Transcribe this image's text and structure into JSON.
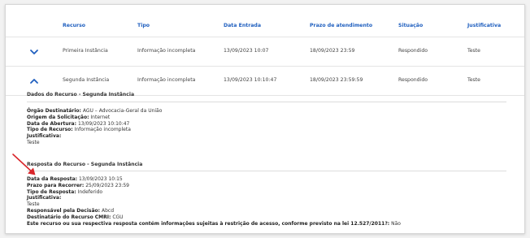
{
  "table": {
    "headers": [
      "Recurso",
      "Tipo",
      "Data Entrada",
      "Prazo de atendimento",
      "Situação",
      "Justificativa"
    ],
    "rows": [
      [
        "Primeira Instância",
        "Informação incompleta",
        "13/09/2023 10:07",
        "18/09/2023 23:59",
        "Respondido",
        "Teste"
      ],
      [
        "Segunda Instância",
        "Informação incompleta",
        "13/09/2023 10:10:47",
        "18/09/2023 23:59:59",
        "Respondido",
        "Teste"
      ]
    ]
  },
  "dados": {
    "title": "Dados do Recurso - Segunda Instância",
    "orgao_label": "Órgão Destinatário:",
    "orgao_value": "AGU – Advocacia-Geral da União",
    "origem_label": "Origem da Solicitação:",
    "origem_value": "Internet",
    "abertura_label": "Data de Abertura:",
    "abertura_value": "13/09/2023 10:10:47",
    "tipo_label": "Tipo de Recurso:",
    "tipo_value": "Informação incompleta",
    "justificativa_label": "Justificativa:",
    "justificativa_value": "Teste"
  },
  "resposta": {
    "title": "Resposta do Recurso - Segunda Instância",
    "data_label": "Data da Resposta:",
    "data_value": "13/09/2023 10:15",
    "prazo_label": "Prazo para Recorrer:",
    "prazo_value": "25/09/2023 23:59",
    "tipo_label": "Tipo de Resposta:",
    "tipo_value": "Indeferido",
    "justificativa_label": "Justificativa:",
    "justificativa_value": "Teste",
    "responsavel_label": "Responsável pela Decisão:",
    "responsavel_value": "Abcd",
    "destinatario_label": "Destinatário do Recurso CMRI:",
    "destinatario_value": "CGU",
    "restricao_label": "Este recurso ou sua respectiva resposta contém informações sujeitas à restrição de acesso, conforme previsto na lei 12.527/2011?:",
    "restricao_value": "Não"
  },
  "colors": {
    "header_text": "#1f5fbf",
    "chevron": "#1f5fbf",
    "arrow": "#d9262b"
  },
  "icons": {
    "row1_toggle": "chevron-down-icon",
    "row2_toggle": "chevron-up-icon",
    "annotation": "red-arrow-icon"
  }
}
